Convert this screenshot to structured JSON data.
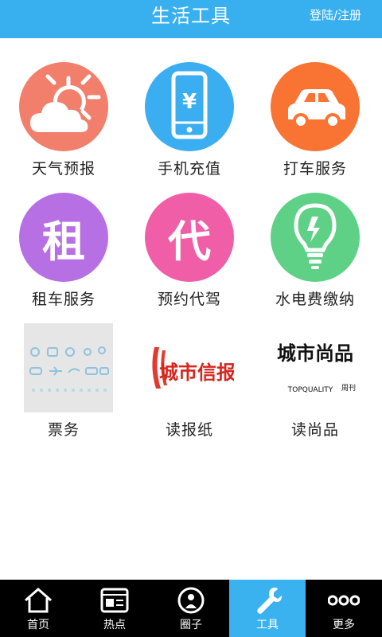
{
  "header": {
    "title": "生活工具",
    "login_label": "登陆/注册"
  },
  "tools": [
    {
      "label": "天气预报",
      "icon": "weather-icon",
      "color": "#f17f6b"
    },
    {
      "label": "手机充值",
      "icon": "phone-recharge-icon",
      "color": "#3aaef0"
    },
    {
      "label": "打车服务",
      "icon": "taxi-icon",
      "color": "#f97333"
    },
    {
      "label": "租车服务",
      "icon": "rent-car-icon",
      "color": "#b76fe4",
      "glyph": "租"
    },
    {
      "label": "预约代驾",
      "icon": "designated-driver-icon",
      "color": "#f05ea8",
      "glyph": "代"
    },
    {
      "label": "水电费缴纳",
      "icon": "utility-bill-icon",
      "color": "#5ed187"
    },
    {
      "label": "票务",
      "icon": "tickets-icon"
    },
    {
      "label": "读报纸",
      "icon": "newspaper-logo",
      "logo_text": "城市信报"
    },
    {
      "label": "读尚品",
      "icon": "magazine-logo",
      "logo_text": "城市尚品",
      "logo_sub": "TOPQUALITY",
      "logo_side": "周刊"
    }
  ],
  "tabs": [
    {
      "label": "首页",
      "icon": "home-icon"
    },
    {
      "label": "热点",
      "icon": "hot-news-icon"
    },
    {
      "label": "圈子",
      "icon": "circle-icon"
    },
    {
      "label": "工具",
      "icon": "wrench-icon",
      "active": true
    },
    {
      "label": "更多",
      "icon": "more-icon"
    }
  ]
}
